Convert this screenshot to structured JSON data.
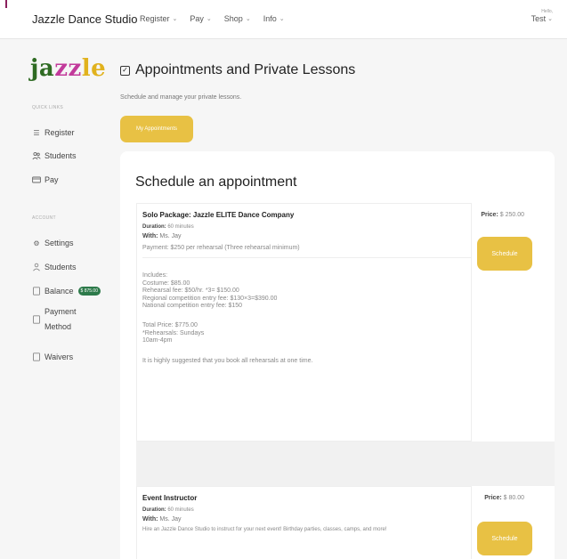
{
  "header": {
    "brand": "Jazzle Dance Studio",
    "nav": [
      {
        "label": "Register"
      },
      {
        "label": "Pay"
      },
      {
        "label": "Shop"
      },
      {
        "label": "Info"
      }
    ],
    "user_greeting": "Hello,",
    "user_name": "Test"
  },
  "sidebar": {
    "logo": {
      "l1": "ja",
      "l2": "zz",
      "l3": "le"
    },
    "quick_links_label": "QUICK LINKS",
    "quick_links": [
      {
        "label": "Register",
        "icon": "list-icon"
      },
      {
        "label": "Students",
        "icon": "users-icon"
      },
      {
        "label": "Pay",
        "icon": "card-icon"
      }
    ],
    "account_label": "ACCOUNT",
    "account": [
      {
        "label": "Settings",
        "icon": "gear-icon"
      },
      {
        "label": "Students",
        "icon": "user-icon"
      },
      {
        "label": "Balance",
        "icon": "document-icon",
        "badge": "$ 875.00"
      },
      {
        "label_1": "Payment",
        "label_2": "Method",
        "icon": "document-icon"
      },
      {
        "label": "Waivers",
        "icon": "document-icon"
      }
    ]
  },
  "main": {
    "title": "Appointments and Private Lessons",
    "subtitle": "Schedule and manage your private lessons.",
    "my_appointments_label": "My Appointments",
    "card_title": "Schedule an appointment",
    "appointments": [
      {
        "name": "Solo Package: Jazzle ELITE Dance Company",
        "duration_label": "Duration:",
        "duration": "60 minutes",
        "with_label": "With:",
        "with": "Ms. Jay",
        "payment": "Payment: $250 per rehearsal (Three rehearsal minimum)",
        "details": [
          "Includes:",
          "Costume: $85.00",
          "Rehearsal fee: $50/hr. *3= $150.00",
          "Regional competition entry fee: $130×3=$390.00",
          "National competition entry fee: $150",
          "",
          "Total Price: $775.00",
          "*Rehearsals: Sundays",
          "10am-4pm",
          "",
          "It is highly suggested that you book all rehearsals at one time."
        ],
        "price_label": "Price:",
        "price": "$ 250.00",
        "schedule_label": "Schedule"
      },
      {
        "name": "Event Instructor",
        "duration_label": "Duration:",
        "duration": "60 minutes",
        "with_label": "With:",
        "with": "Ms. Jay",
        "description": "Hire an Jazzle Dance Studio to instruct for your next event! Birthday parties, classes, camps, and more!",
        "price_label": "Price:",
        "price": "$ 80.00",
        "schedule_label": "Schedule"
      }
    ]
  }
}
